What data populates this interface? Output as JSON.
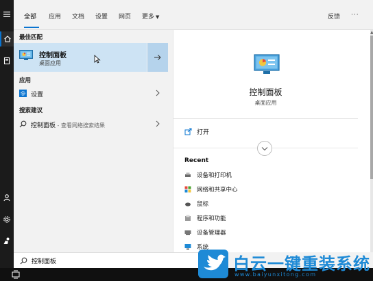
{
  "tabs": [
    {
      "label": "全部",
      "active": true
    },
    {
      "label": "应用"
    },
    {
      "label": "文档"
    },
    {
      "label": "设置"
    },
    {
      "label": "网页"
    },
    {
      "label": "更多"
    }
  ],
  "header_right": {
    "feedback": "反馈",
    "more": "···"
  },
  "results": {
    "best_match_heading": "最佳匹配",
    "best_match": {
      "title": "控制面板",
      "subtitle": "桌面应用"
    },
    "apps_heading": "应用",
    "apps": [
      {
        "label": "设置"
      }
    ],
    "suggest_heading": "搜索建议",
    "suggestions": [
      {
        "label": "控制面板",
        "sub": " - 查看网络搜索结果"
      }
    ]
  },
  "preview": {
    "title": "控制面板",
    "subtitle": "桌面应用",
    "open_label": "打开",
    "recent_heading": "Recent",
    "recent": [
      {
        "label": "设备和打印机",
        "icon": "printer-icon"
      },
      {
        "label": "网络和共享中心",
        "icon": "network-icon"
      },
      {
        "label": "鼠标",
        "icon": "mouse-icon"
      },
      {
        "label": "程序和功能",
        "icon": "programs-icon"
      },
      {
        "label": "设备管理器",
        "icon": "device-manager-icon"
      },
      {
        "label": "系统",
        "icon": "system-icon"
      }
    ]
  },
  "search": {
    "query": "控制面板"
  },
  "watermark": {
    "name": "白云一键重装系统",
    "url": "www.baiyunxitong.com"
  },
  "colors": {
    "accent": "#0a74d0",
    "selection": "#cde3f4",
    "watermark": "#1e8ad6"
  }
}
